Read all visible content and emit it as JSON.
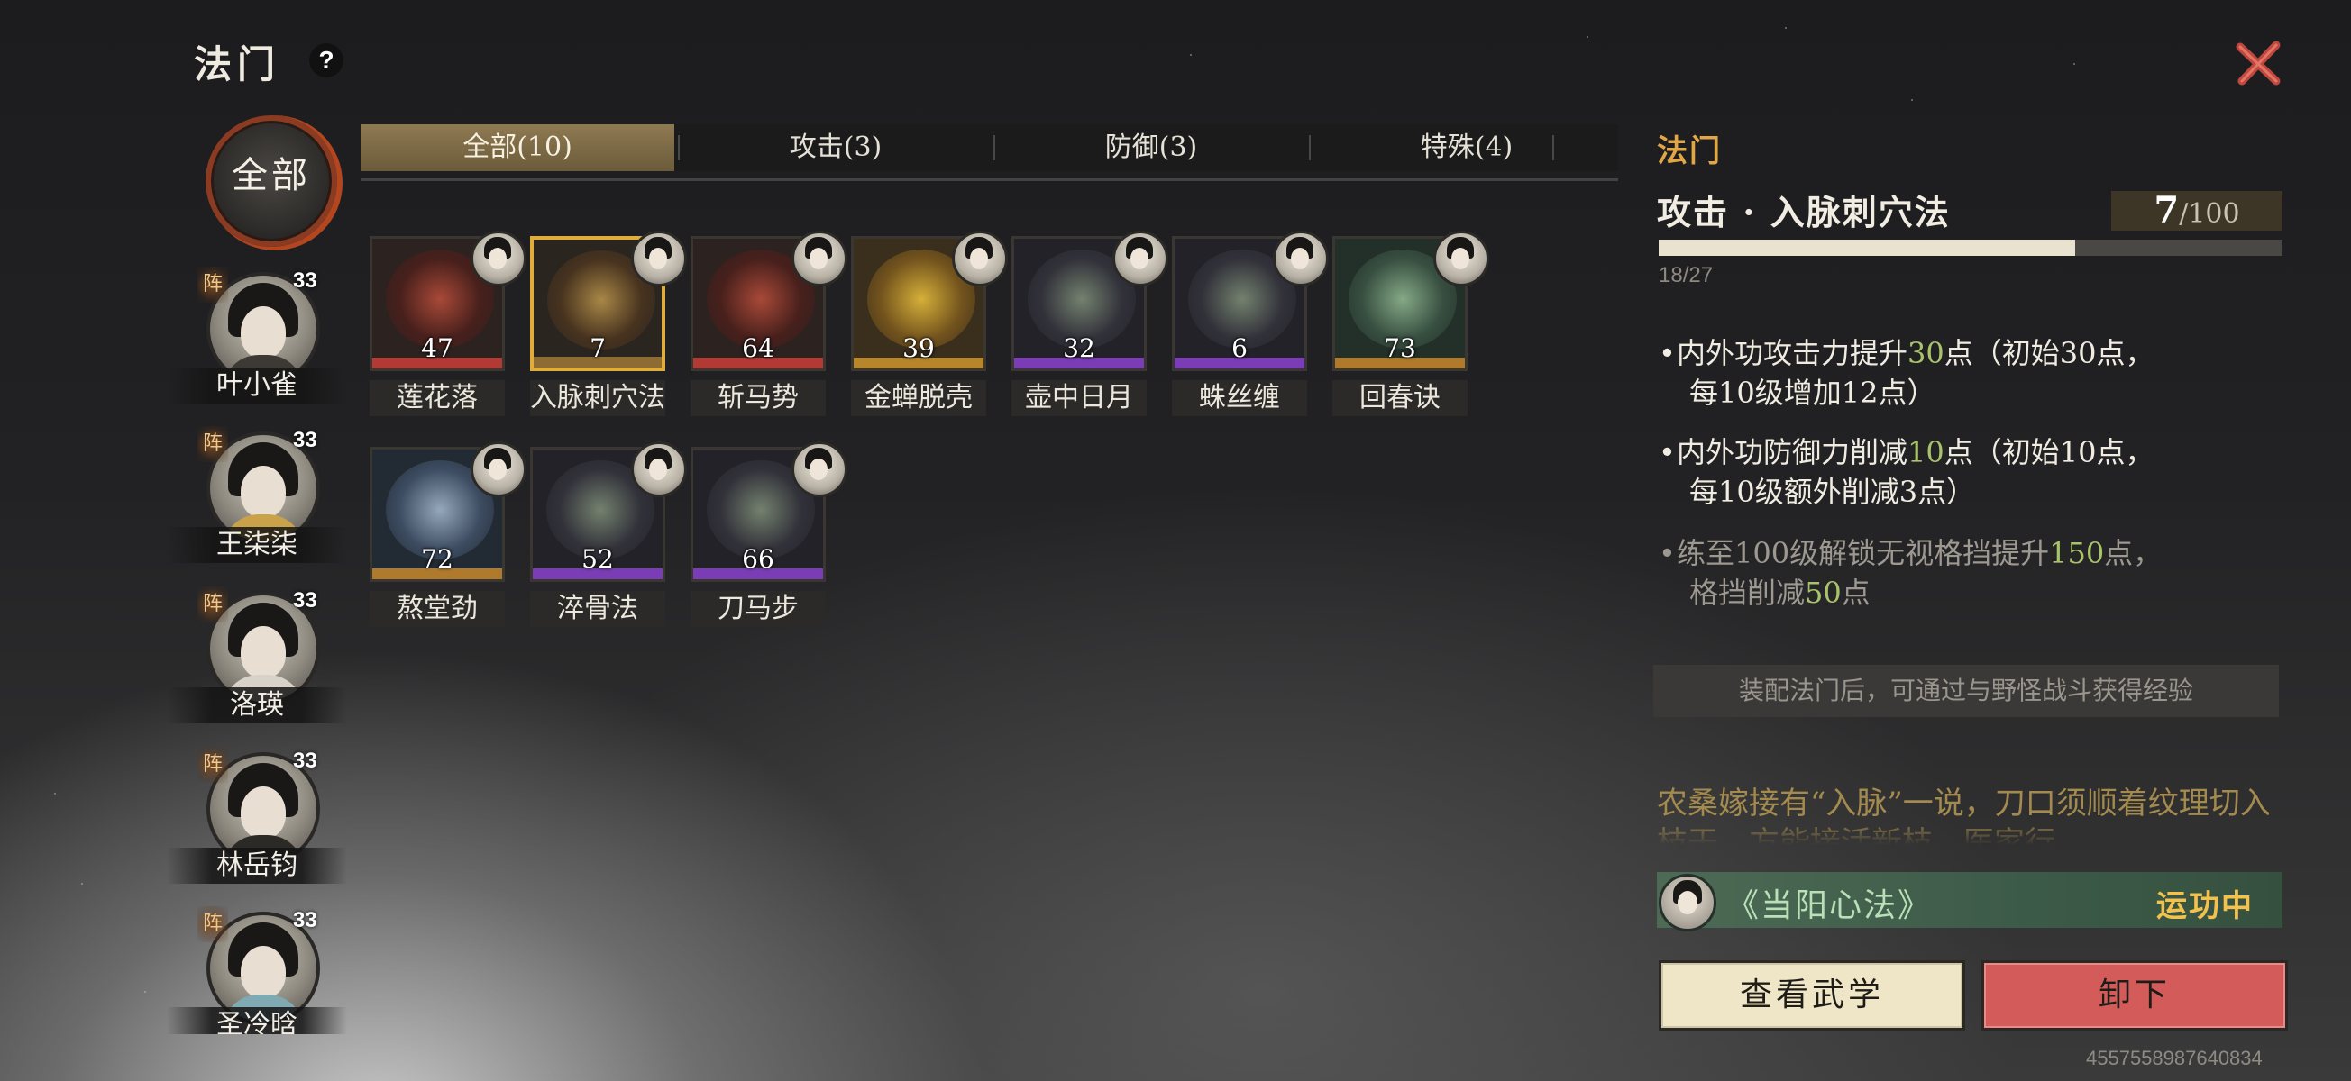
{
  "header": {
    "title": "法门",
    "help_label": "?",
    "close_label": "✕"
  },
  "team": {
    "all_label": "全部",
    "members": [
      {
        "name": "叶小雀",
        "level": "33",
        "tag": "阵"
      },
      {
        "name": "王柒柒",
        "level": "33",
        "tag": "阵"
      },
      {
        "name": "洛瑛",
        "level": "33",
        "tag": "阵"
      },
      {
        "name": "林岳钧",
        "level": "33",
        "tag": "阵"
      },
      {
        "name": "圣冷晗",
        "level": "33",
        "tag": "阵"
      }
    ]
  },
  "tabs": [
    {
      "label": "全部(10)",
      "active": true
    },
    {
      "label": "攻击(3)",
      "active": false
    },
    {
      "label": "防御(3)",
      "active": false
    },
    {
      "label": "特殊(4)",
      "active": false
    }
  ],
  "skills": [
    {
      "name": "莲花落",
      "level": "47",
      "theme": "red"
    },
    {
      "name": "入脉刺穴法",
      "level": "7",
      "theme": "gold",
      "selected": true
    },
    {
      "name": "斩马势",
      "level": "64",
      "theme": "red"
    },
    {
      "name": "金蝉脱壳",
      "level": "39",
      "theme": "yellow"
    },
    {
      "name": "壶中日月",
      "level": "32",
      "theme": "purple"
    },
    {
      "name": "蛛丝缠",
      "level": "6",
      "theme": "purple"
    },
    {
      "name": "回春诀",
      "level": "73",
      "theme": "green"
    },
    {
      "name": "熬堂劲",
      "level": "72",
      "theme": "blue"
    },
    {
      "name": "淬骨法",
      "level": "52",
      "theme": "purple"
    },
    {
      "name": "刀马步",
      "level": "66",
      "theme": "purple"
    }
  ],
  "detail": {
    "section_title": "法门",
    "skill_title": "攻击 · 入脉刺穴法",
    "level_current": "7",
    "level_max": "/100",
    "xp_text": "18/27",
    "xp_fraction": 0.667,
    "effects": [
      {
        "pre": "内外功攻击力提升",
        "hl": "30",
        "post": "点（初始30点，",
        "line2": "每10级增加12点）"
      },
      {
        "pre": "内外功防御力削减",
        "hl": "10",
        "post": "点（初始10点，",
        "line2": "每10级额外削减3点）"
      }
    ],
    "unlock": {
      "pre": "练至100级解锁无视格挡提升",
      "hl1": "150",
      "mid": "点，",
      "line2_pre": "格挡削减",
      "hl2": "50",
      "line2_post": "点"
    },
    "hint": "装配法门后，可通过与野怪战斗获得经验",
    "lore": "农桑嫁接有“入脉”一说，刀口须顺着纹理切入枝干，方能接活新枝。医家行"
  },
  "equip": {
    "name": "《当阳心法》",
    "status": "运功中"
  },
  "actions": {
    "view_label": "查看武学",
    "unequip_label": "卸下"
  },
  "uid": "4557558987640834",
  "colors": {
    "accent_gold": "#e1a747",
    "highlight_green": "#a9c36a",
    "unequip_red": "#d35c5a"
  }
}
